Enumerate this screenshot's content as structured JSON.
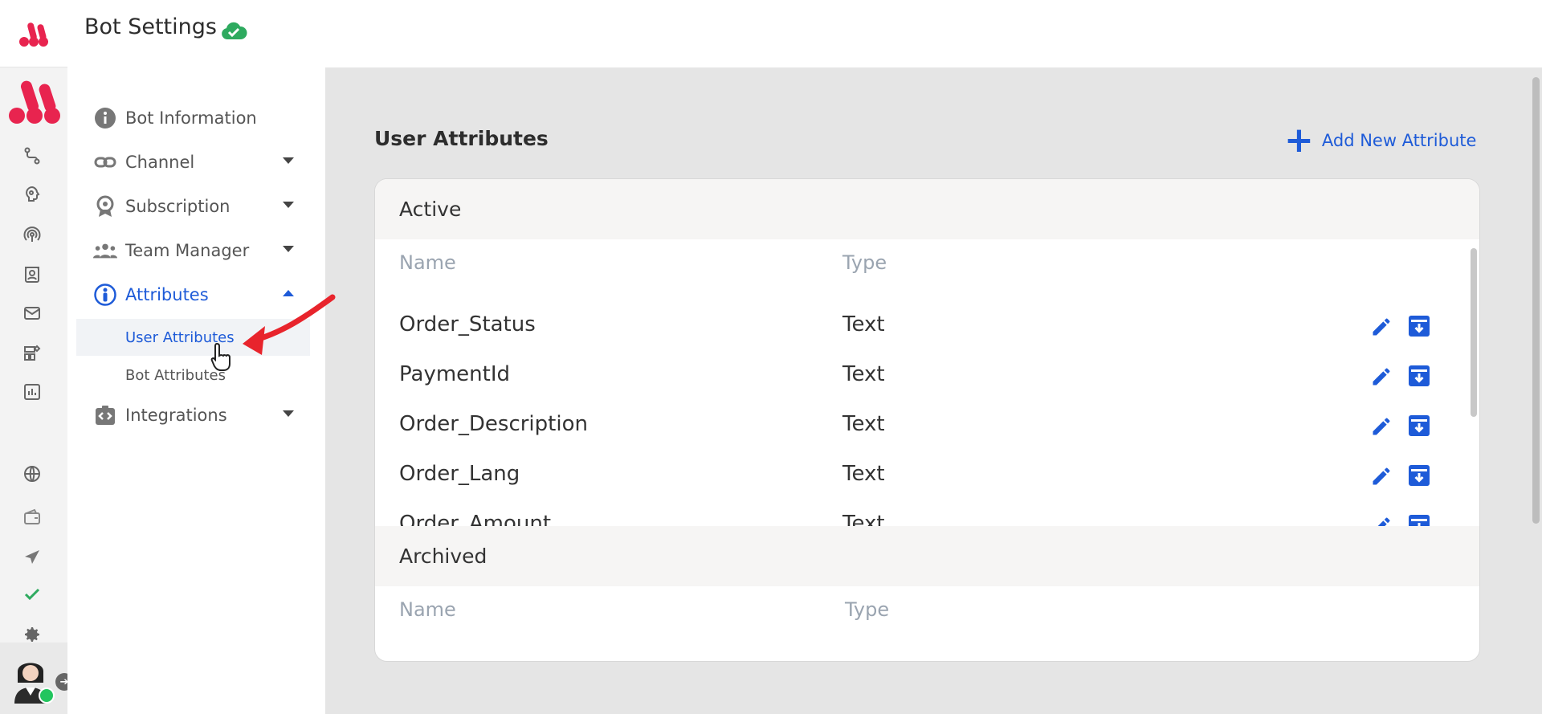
{
  "header": {
    "title": "Bot Settings",
    "status_icon": "cloud-check-icon",
    "status_color": "#2eaa5f"
  },
  "rail": {
    "brand_color": "#e8244f",
    "icons": [
      "flow-icon",
      "brain-icon",
      "broadcast-icon",
      "contacts-icon",
      "mail-icon",
      "widgets-icon",
      "analytics-icon",
      "globe-icon",
      "wallet-icon",
      "send-icon",
      "check-icon",
      "gear-icon"
    ]
  },
  "menu": {
    "items": [
      {
        "label": "Bot Information",
        "icon": "info-icon"
      },
      {
        "label": "Channel",
        "icon": "link-icon"
      },
      {
        "label": "Subscription",
        "icon": "badge-icon"
      },
      {
        "label": "Team Manager",
        "icon": "team-icon"
      },
      {
        "label": "Attributes",
        "icon": "person-icon"
      },
      {
        "label": "Integrations",
        "icon": "integration-icon"
      }
    ],
    "sub_items": [
      "User Attributes",
      "Bot Attributes"
    ]
  },
  "main": {
    "section_title": "User Attributes",
    "add_label": "Add New Attribute",
    "accent_color": "#1e5bd8",
    "active": {
      "title": "Active",
      "col_name": "Name",
      "col_type": "Type",
      "rows": [
        {
          "name": "Order_Status",
          "type": "Text"
        },
        {
          "name": "PaymentId",
          "type": "Text"
        },
        {
          "name": "Order_Description",
          "type": "Text"
        },
        {
          "name": "Order_Lang",
          "type": "Text"
        },
        {
          "name": "Order_Amount",
          "type": "Text"
        }
      ]
    },
    "archived": {
      "title": "Archived",
      "col_name": "Name",
      "col_type": "Type"
    }
  }
}
